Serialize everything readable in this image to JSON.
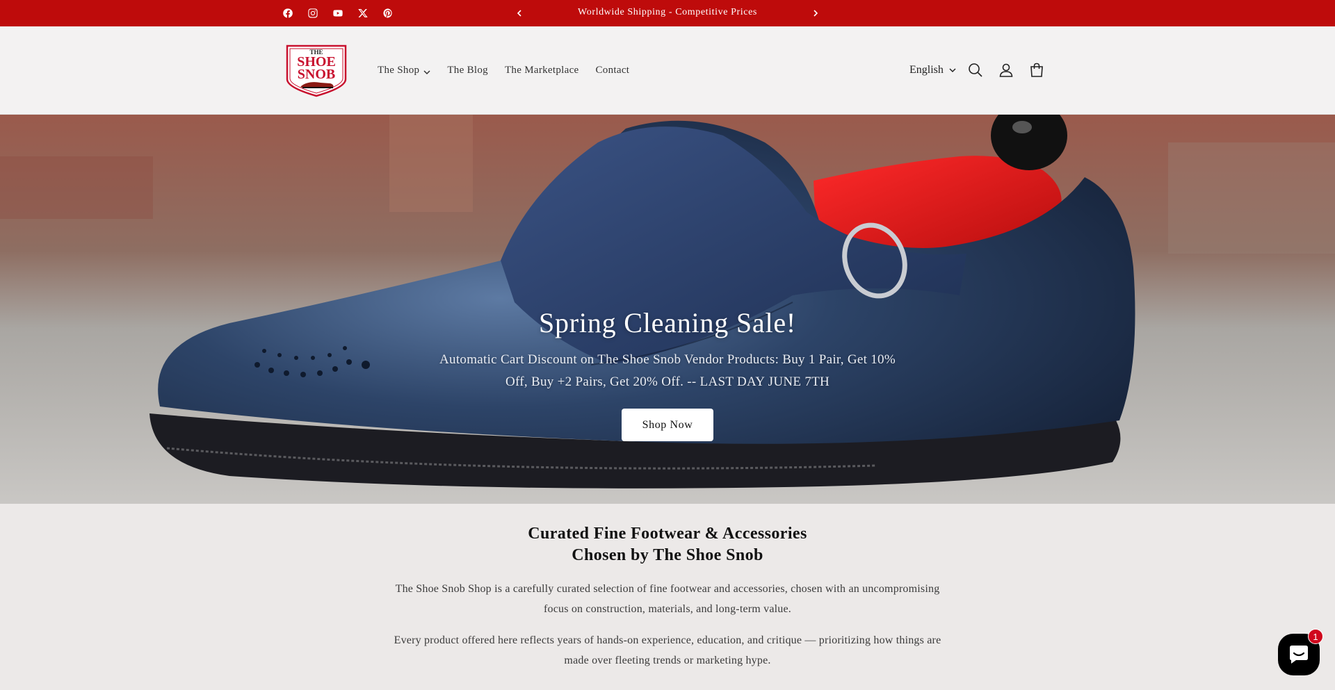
{
  "announcement": {
    "text": "Worldwide Shipping - Competitive Prices",
    "socials": [
      "facebook-icon",
      "instagram-icon",
      "youtube-icon",
      "x-icon",
      "pinterest-icon"
    ],
    "background": "#be0b0b"
  },
  "header": {
    "logo": {
      "line1": "THE",
      "line2": "SHOE",
      "line3": "SNOB"
    },
    "nav": [
      {
        "label": "The Shop",
        "has_dropdown": true
      },
      {
        "label": "The Blog"
      },
      {
        "label": "The Marketplace"
      },
      {
        "label": "Contact"
      }
    ],
    "language": "English",
    "icons": [
      "search-icon",
      "account-icon",
      "cart-icon"
    ]
  },
  "hero": {
    "title": "Spring Cleaning Sale!",
    "subtitle": "Automatic Cart Discount on The Shoe Snob Vendor Products: Buy 1 Pair, Get 10% Off, Buy +2 Pairs, Get 20% Off. -- LAST DAY JUNE 7TH",
    "button": "Shop Now"
  },
  "intro": {
    "heading_line1": "Curated Fine Footwear & Accessories",
    "heading_line2": "Chosen by The Shoe Snob",
    "paragraph1": "The Shoe Snob Shop is a carefully curated selection of fine footwear and accessories, chosen with an uncompromising focus on construction, materials, and long-term value.",
    "paragraph2": "Every product offered here reflects years of hands-on experience, education, and critique — prioritizing how things are made over fleeting trends or marketing hype."
  },
  "chat": {
    "badge": "1"
  }
}
